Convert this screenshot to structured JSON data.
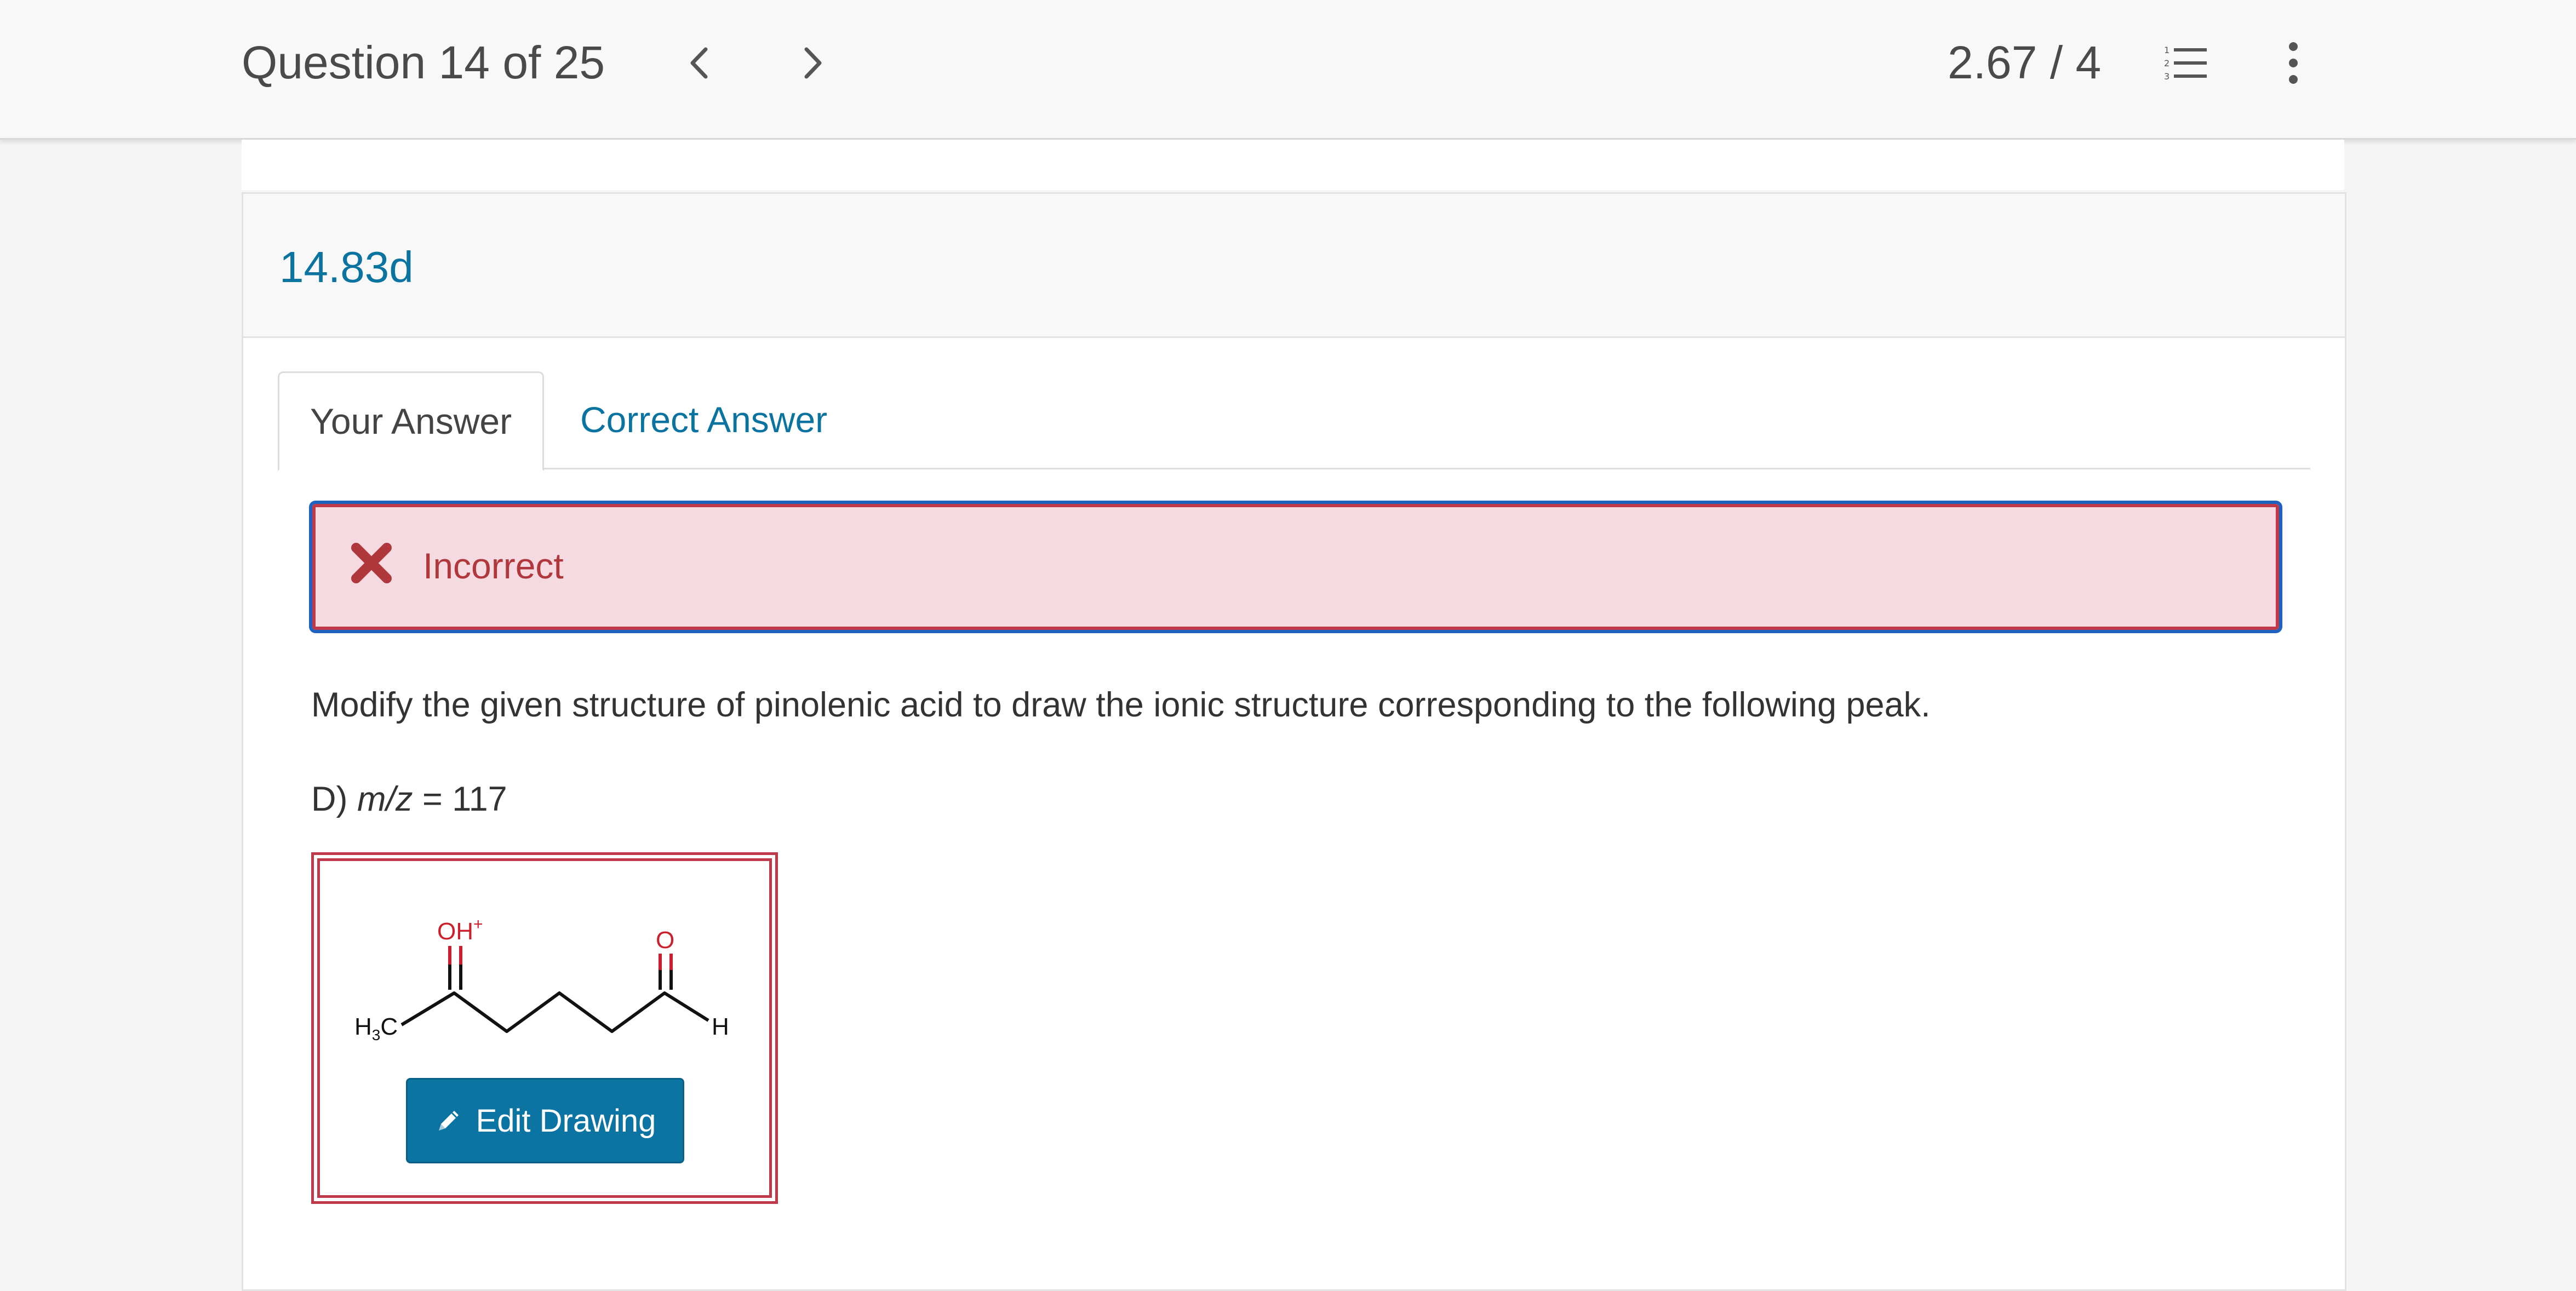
{
  "header": {
    "question_label": "Question 14 of 25",
    "score": "2.67 / 4",
    "icons": {
      "prev": "chevron-left-icon",
      "next": "chevron-right-icon",
      "list": "numbered-list-icon",
      "more": "more-vertical-icon"
    }
  },
  "question": {
    "id": "14.83d",
    "tabs": [
      {
        "label": "Your Answer",
        "active": true
      },
      {
        "label": "Correct Answer",
        "active": false
      }
    ],
    "status": {
      "text": "Incorrect",
      "icon": "x-mark-icon",
      "color": "#b0383d"
    },
    "prompt": "Modify the given structure of pinolenic acid to draw the ionic structure corresponding to the following peak.",
    "part_prefix": "D) ",
    "part_var": "m/z",
    "part_suffix": " = 117",
    "structure": {
      "labels": {
        "oh_plus_main": "OH",
        "oh_plus_charge": "+",
        "o": "O",
        "h3c_h": "H",
        "h3c_sub": "3",
        "h3c_c": "C",
        "h_end": "H"
      }
    },
    "edit_button": {
      "label": "Edit Drawing",
      "icon": "pencil-icon"
    }
  },
  "colors": {
    "accent": "#0a73a0",
    "error": "#c0394a",
    "error_bg": "#f5dbe1",
    "focus_outline": "#1e63c0"
  }
}
